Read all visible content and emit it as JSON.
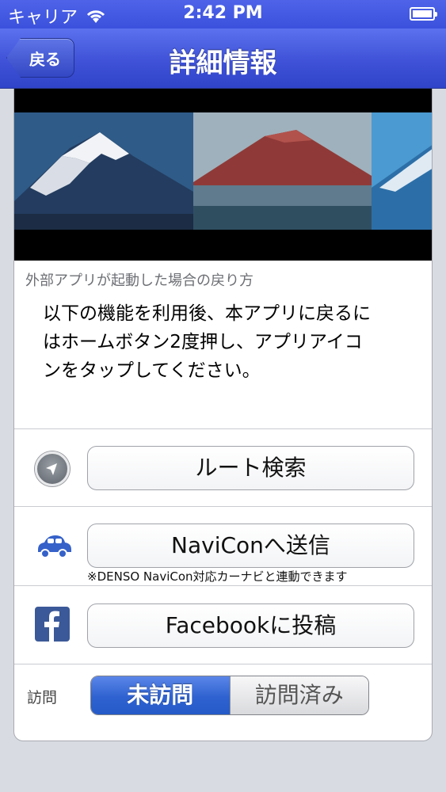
{
  "status_bar": {
    "carrier": "キャリア",
    "time": "2:42 PM",
    "icons": [
      "wifi-icon",
      "battery-icon"
    ]
  },
  "nav": {
    "back_label": "戻る",
    "title": "詳細情報"
  },
  "photos": [
    "mt-fuji-snow-photo",
    "mt-fuji-red-photo",
    "mt-fuji-blue-photo"
  ],
  "external_app": {
    "label": "外部アプリが起動した場合の戻り方",
    "body_lines": [
      "以下の機能を利用後、本アプリに戻るに",
      "はホームボタン2度押し、アプリアイコ",
      "ンをタップしてください。"
    ]
  },
  "actions": {
    "route": {
      "label": "ルート検索",
      "icon": "compass-icon"
    },
    "navicon": {
      "label": "NaviConへ送信",
      "note": "※DENSO NaviCon対応カーナビと連動できます",
      "icon": "car-icon"
    },
    "facebook": {
      "label": "Facebookに投稿",
      "icon": "facebook-icon"
    }
  },
  "visit": {
    "label": "訪問",
    "options": [
      "未訪問",
      "訪問済み"
    ],
    "selected": "未訪問"
  },
  "colors": {
    "nav_blue": "#3f52d8",
    "segment_selected": "#2f62d0",
    "facebook_blue": "#3b5998",
    "car_blue": "#3561c9"
  }
}
